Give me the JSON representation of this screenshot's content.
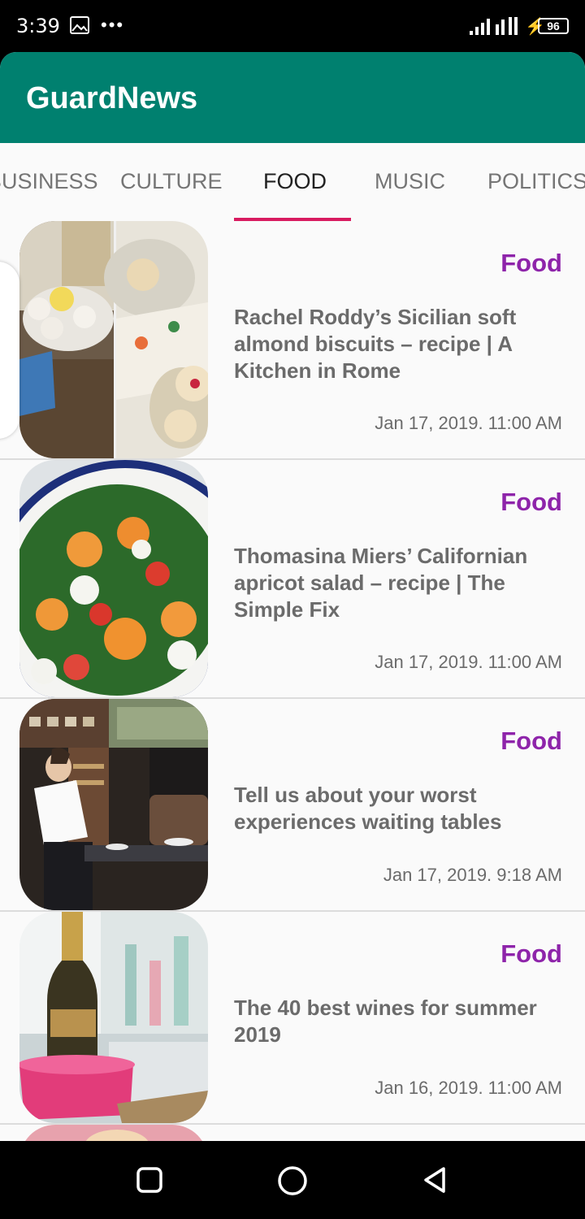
{
  "status_bar": {
    "time": "3:39",
    "more": "•••",
    "battery": "96",
    "icons": [
      "image-icon",
      "signal-icon",
      "charging-icon",
      "battery-icon"
    ]
  },
  "app": {
    "title": "GuardNews",
    "accent_color": "#00806f",
    "tab_indicator_color": "#d81b60",
    "section_color": "#8e24aa"
  },
  "tabs": [
    {
      "label": "BUSINESS"
    },
    {
      "label": "CULTURE"
    },
    {
      "label": "FOOD"
    },
    {
      "label": "MUSIC"
    },
    {
      "label": "POLITICS"
    }
  ],
  "articles": [
    {
      "section": "Food",
      "headline": "Rachel Roddy’s Sicilian soft almond biscuits – recipe | A Kitchen in Rome",
      "date": "Jan 17, 2019. 11:00 AM",
      "image": "biscuits-photo"
    },
    {
      "section": "Food",
      "headline": "Thomasina Miers’ Californian apricot salad – recipe | The Simple Fix",
      "date": "Jan 17, 2019. 11:00 AM",
      "image": "apricot-salad-photo"
    },
    {
      "section": "Food",
      "headline": "Tell us about your worst experiences waiting tables",
      "date": "Jan 17, 2019. 9:18 AM",
      "image": "restaurant-photo"
    },
    {
      "section": "Food",
      "headline": "The 40 best wines for summer 2019",
      "date": "Jan 16, 2019. 11:00 AM",
      "image": "champagne-photo"
    }
  ],
  "nav": {
    "icons": [
      "recents-icon",
      "home-icon",
      "back-icon"
    ]
  }
}
